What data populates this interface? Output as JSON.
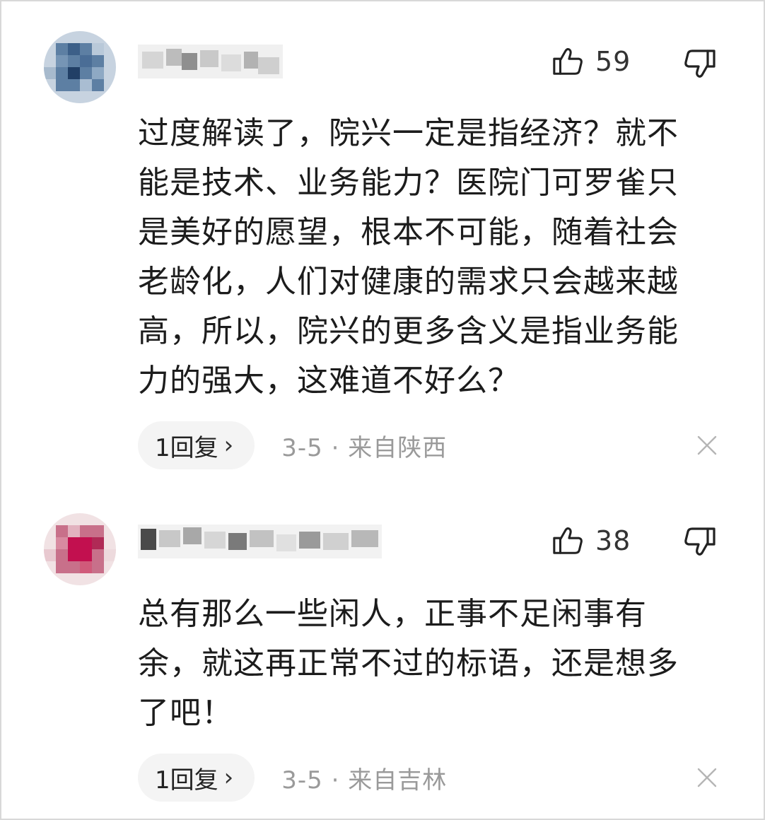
{
  "comments": [
    {
      "likes": "59",
      "lines": [
        "过度解读了，院兴一定是指经济？就不",
        "能是技术、业务能力？医院门可罗雀只",
        "是美好的愿望，根本不可能，随着社会",
        "老龄化，人们对健康的需求只会越来越",
        "高，所以，院兴的更多含义是指业务能",
        "力的强大，这难道不好么？"
      ],
      "reply_label": "1回复",
      "reply_chevron": "›",
      "date": "3-5",
      "separator": "·",
      "location": "来自陕西"
    },
    {
      "likes": "38",
      "lines": [
        "总有那么一些闲人，正事不足闲事有",
        "余，就这再正常不过的标语，还是想多",
        "了吧！"
      ],
      "reply_label": "1回复",
      "reply_chevron": "›",
      "date": "3-5",
      "separator": "·",
      "location": "来自吉林"
    }
  ],
  "icons": {
    "like": "thumbs-up-icon",
    "dislike": "thumbs-down-icon",
    "close": "close-icon"
  },
  "colors": {
    "text": "#1c1c1c",
    "meta": "#9a9a9a",
    "pill": "#f4f4f4"
  }
}
